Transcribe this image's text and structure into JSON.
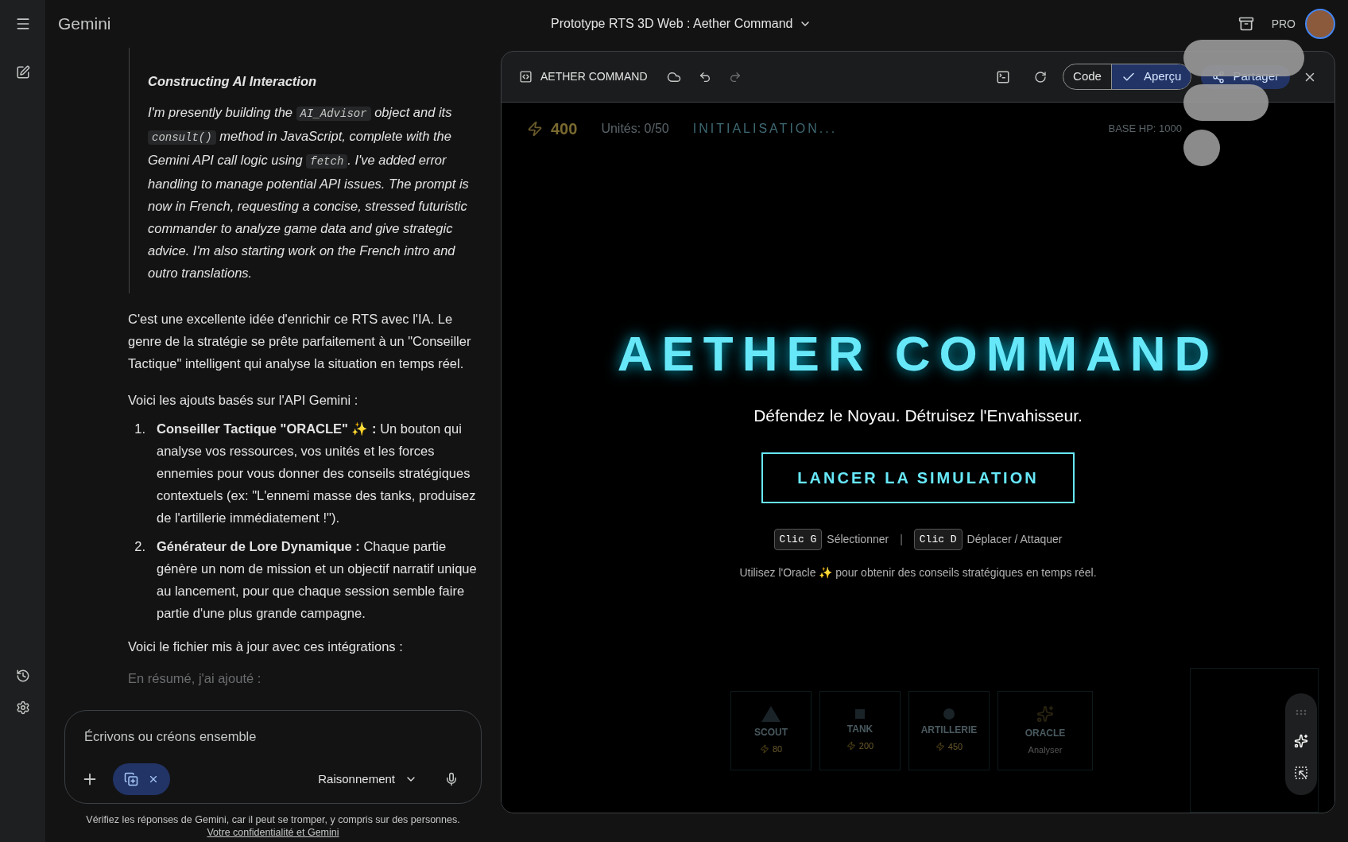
{
  "app": {
    "name": "Gemini"
  },
  "conversation_title": "Prototype RTS 3D Web : Aether Command",
  "header": {
    "badge": "PRO"
  },
  "thinking": {
    "heading": "Constructing AI Interaction",
    "segments": [
      {
        "kind": "text",
        "text": "I'm presently building the "
      },
      {
        "kind": "code",
        "text": "AI_Advisor"
      },
      {
        "kind": "text",
        "text": " object and its "
      },
      {
        "kind": "code",
        "text": "consult()"
      },
      {
        "kind": "text",
        "text": " method in JavaScript, complete with the Gemini API call logic using "
      },
      {
        "kind": "code",
        "text": "fetch"
      },
      {
        "kind": "text",
        "text": ". I've added error handling to manage potential API issues. The prompt is now in French, requesting a concise, stressed futuristic commander to analyze game data and give strategic advice. I'm also starting work on the French intro and outro translations."
      }
    ]
  },
  "response": {
    "intro": [
      "C'est une excellente idée d'enrichir ce RTS avec l'IA. Le genre de la stratégie se prête parfaitement à un \"Conseiller Tactique\" intelligent qui analyse la situation en temps réel.",
      "Voici les ajouts basés sur l'API Gemini :"
    ],
    "list": [
      {
        "number": "1.",
        "title": "Conseiller Tactique \"ORACLE\" ✨ :",
        "text": "Un bouton qui analyse vos ressources, vos unités et les forces ennemies pour vous donner des conseils stratégiques contextuels (ex: \"L'ennemi masse des tanks, produisez de l'artillerie immédiatement !\")."
      },
      {
        "number": "2.",
        "title": "Générateur de Lore Dynamique :",
        "text": "Chaque partie génère un nom de mission et un objectif narratif unique au lancement, pour que chaque session semble faire partie d'une plus grande campagne."
      }
    ],
    "outro": "Voici le fichier mis à jour avec ces intégrations :",
    "faded": "En résumé, j'ai ajouté :"
  },
  "composer": {
    "placeholder": "Écrivons ou créons ensemble",
    "mode": "Raisonnement"
  },
  "disclaimer": {
    "text": "Vérifiez les réponses de Gemini, car il peut se tromper, y compris sur des personnes.",
    "link": "Votre confidentialité et Gemini"
  },
  "canvas": {
    "title": "AETHER COMMAND",
    "view_toggle": [
      {
        "label": "Code",
        "selected": false
      },
      {
        "label": "Aperçu",
        "selected": true
      }
    ],
    "share": "Partager"
  },
  "game": {
    "hud": {
      "energy": "400",
      "units": "Unités: 0/50",
      "status": "INITIALISATION...",
      "base_hp": "BASE HP: 1000"
    },
    "title": "AETHER COMMAND",
    "tagline": "Défendez le Noyau. Détruisez l'Envahisseur.",
    "start_button": "LANCER LA SIMULATION",
    "controls": [
      {
        "key": "Clic G",
        "action": "Sélectionner"
      },
      {
        "key": "Clic D",
        "action": "Déplacer / Attaquer"
      }
    ],
    "separator": "|",
    "hint": "Utilisez l'Oracle ✨ pour obtenir des conseils stratégiques en temps réel.",
    "units": [
      {
        "kind": "triangle",
        "name": "SCOUT",
        "cost": "80"
      },
      {
        "kind": "square",
        "name": "TANK",
        "cost": "200"
      },
      {
        "kind": "circle",
        "name": "ARTILLERIE",
        "cost": "450"
      },
      {
        "kind": "oracle",
        "name": "ORACLE",
        "note": "Analyser"
      }
    ]
  }
}
